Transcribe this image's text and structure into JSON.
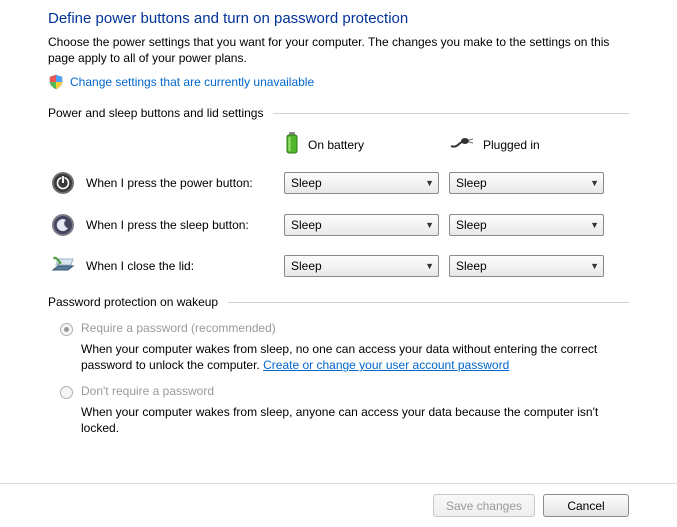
{
  "heading": "Define power buttons and turn on password protection",
  "description": "Choose the power settings that you want for your computer. The changes you make to the settings on this page apply to all of your power plans.",
  "change_link": "Change settings that are currently unavailable",
  "sections": {
    "buttons_lid": {
      "title": "Power and sleep buttons and lid settings",
      "col_battery": "On battery",
      "col_plugged": "Plugged in",
      "rows": {
        "power": {
          "label": "When I press the power button:",
          "battery": "Sleep",
          "plugged": "Sleep"
        },
        "sleep": {
          "label": "When I press the sleep button:",
          "battery": "Sleep",
          "plugged": "Sleep"
        },
        "lid": {
          "label": "When I close the lid:",
          "battery": "Sleep",
          "plugged": "Sleep"
        }
      }
    },
    "password": {
      "title": "Password protection on wakeup",
      "require": {
        "label": "Require a password (recommended)",
        "desc_a": "When your computer wakes from sleep, no one can access your data without entering the correct password to unlock the computer. ",
        "link": "Create or change your user account password"
      },
      "dont": {
        "label": "Don't require a password",
        "desc": "When your computer wakes from sleep, anyone can access your data because the computer isn't locked."
      }
    }
  },
  "footer": {
    "save": "Save changes",
    "cancel": "Cancel"
  }
}
